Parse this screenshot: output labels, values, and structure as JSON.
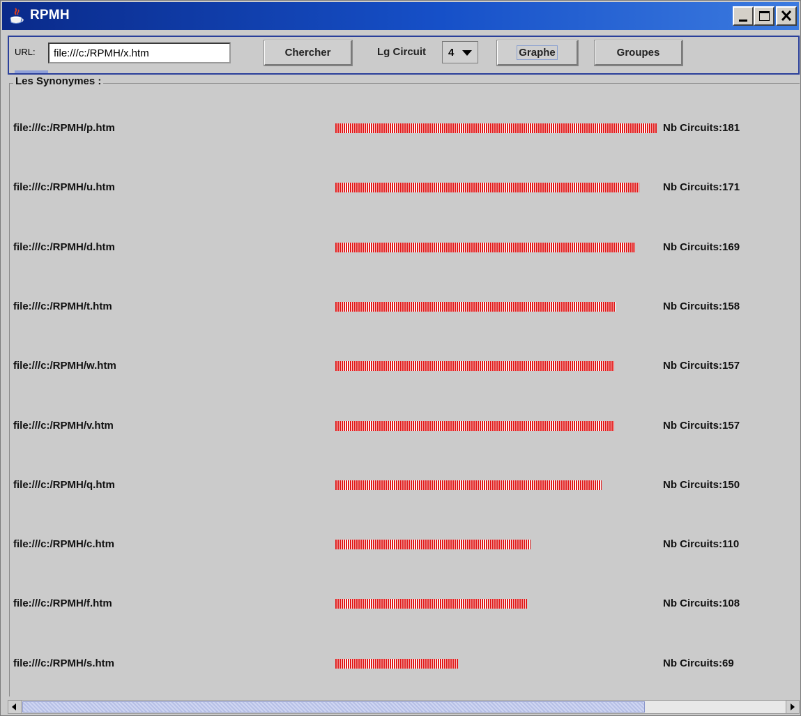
{
  "window": {
    "title": "RPMH",
    "icons": [
      "java-icon",
      "minimize-icon",
      "maximize-icon",
      "close-icon"
    ]
  },
  "toolbar": {
    "url_label": "URL:",
    "url_value": "file:///c:/RPMH/x.htm",
    "search_label": "Chercher",
    "lg_circuit_label": "Lg Circuit",
    "lg_circuit_value": "4",
    "graph_label": "Graphe",
    "groups_label": "Groupes"
  },
  "synonyms": {
    "title": "Les Synonymes :",
    "bar_color": "#e01a1a",
    "items": [
      {
        "file": "file:///c:/RPMH/p.htm",
        "count_text": "Nb Circuits:181",
        "value": 181
      },
      {
        "file": "file:///c:/RPMH/u.htm",
        "count_text": "Nb Circuits:171",
        "value": 171
      },
      {
        "file": "file:///c:/RPMH/d.htm",
        "count_text": "Nb Circuits:169",
        "value": 169
      },
      {
        "file": "file:///c:/RPMH/t.htm",
        "count_text": "Nb Circuits:158",
        "value": 158
      },
      {
        "file": "file:///c:/RPMH/w.htm",
        "count_text": "Nb Circuits:157",
        "value": 157
      },
      {
        "file": "file:///c:/RPMH/v.htm",
        "count_text": "Nb Circuits:157",
        "value": 157
      },
      {
        "file": "file:///c:/RPMH/q.htm",
        "count_text": "Nb Circuits:150",
        "value": 150
      },
      {
        "file": "file:///c:/RPMH/c.htm",
        "count_text": "Nb Circuits:110",
        "value": 110
      },
      {
        "file": "file:///c:/RPMH/f.htm",
        "count_text": "Nb Circuits:108",
        "value": 108
      },
      {
        "file": "file:///c:/RPMH/s.htm",
        "count_text": "Nb Circuits:69",
        "value": 69
      }
    ]
  },
  "scrollbar": {
    "visible_fraction": 0.8
  }
}
